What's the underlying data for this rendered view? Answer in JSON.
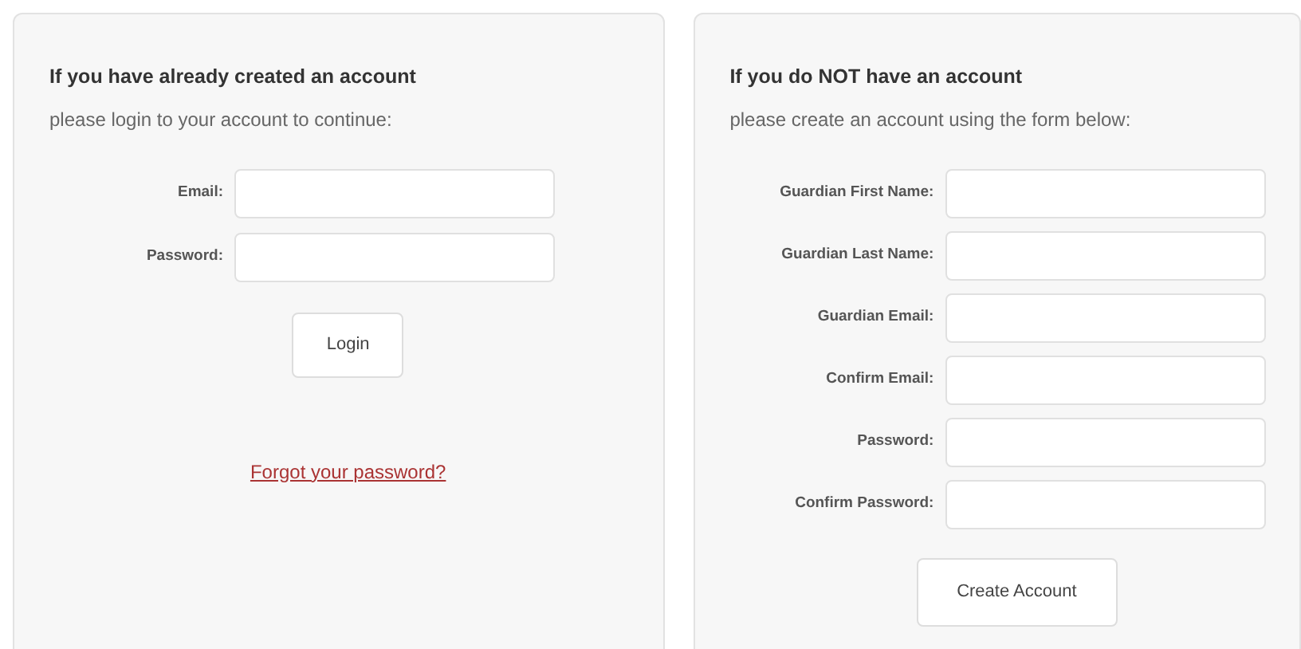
{
  "login_panel": {
    "heading": "If you have already created an account",
    "subtitle": "please login to your account to continue:",
    "fields": [
      {
        "label": "Email:"
      },
      {
        "label": "Password:"
      }
    ],
    "button": "Login",
    "forgot_link": "Forgot your password?"
  },
  "register_panel": {
    "heading": "If you do NOT have an account",
    "subtitle": "please create an account using the form below:",
    "fields": [
      {
        "label": "Guardian First Name:"
      },
      {
        "label": "Guardian Last Name:"
      },
      {
        "label": "Guardian Email:"
      },
      {
        "label": "Confirm Email:"
      },
      {
        "label": "Password:"
      },
      {
        "label": "Confirm Password:"
      }
    ],
    "button": "Create Account"
  }
}
